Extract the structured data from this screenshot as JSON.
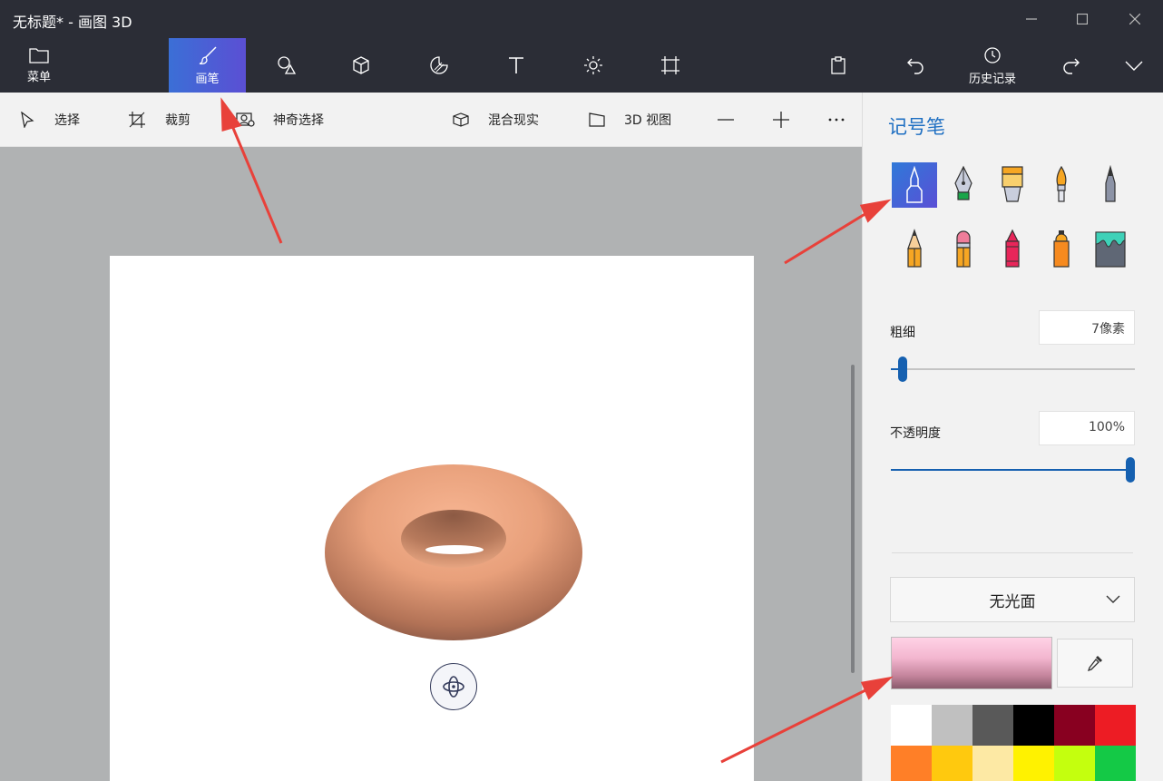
{
  "window": {
    "title": "无标题* - 画图 3D"
  },
  "ribbon": {
    "menu_label": "菜单",
    "brushes_label": "画笔",
    "history_label": "历史记录"
  },
  "toolbar": {
    "select_label": "选择",
    "crop_label": "裁剪",
    "magic_select_label": "神奇选择",
    "mixed_reality_label": "混合现实",
    "view3d_label": "3D 视图"
  },
  "panel": {
    "title": "记号笔",
    "brushes": [
      {
        "name": "marker-icon",
        "selected": true
      },
      {
        "name": "calligraphy-pen-icon"
      },
      {
        "name": "oil-brush-icon"
      },
      {
        "name": "watercolor-icon"
      },
      {
        "name": "pixel-pen-icon"
      },
      {
        "name": "pencil-icon"
      },
      {
        "name": "eraser-icon"
      },
      {
        "name": "crayon-icon"
      },
      {
        "name": "spray-can-icon"
      },
      {
        "name": "fill-bucket-icon"
      }
    ],
    "thickness_label": "粗细",
    "thickness_value": "7像素",
    "thickness_level": 0.05,
    "opacity_label": "不透明度",
    "opacity_value": "100%",
    "opacity_level": 1.0,
    "finish_select": "无光面",
    "current_color": "#e8a7c0",
    "palette": [
      "#ffffff",
      "#c0c0c0",
      "#595959",
      "#000000",
      "#880020",
      "#ed1c24",
      "#ff7f27",
      "#ffc90e",
      "#fde9a4",
      "#fff200",
      "#c4ff0e",
      "#14c946"
    ]
  },
  "colors": {
    "accent": "#1e6fc2",
    "ribbon_bg": "#2b2d36",
    "arrow": "#e8413a"
  }
}
